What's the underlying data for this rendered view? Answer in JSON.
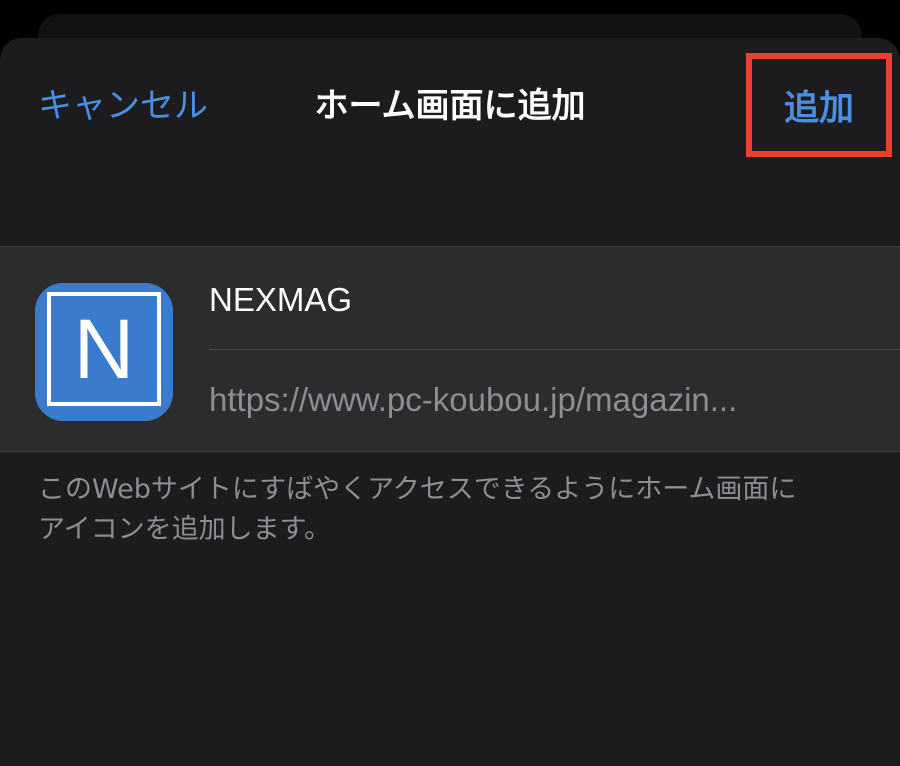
{
  "nav": {
    "cancel_label": "キャンセル",
    "title": "ホーム画面に追加",
    "add_label": "追加"
  },
  "bookmark": {
    "icon_letter": "N",
    "name": "NEXMAG",
    "url": "https://www.pc-koubou.jp/magazin..."
  },
  "footer": {
    "line1": "このWebサイトにすばやくアクセスできるようにホーム画面に",
    "line2": "アイコンを追加します。"
  },
  "colors": {
    "accent": "#4a90e2",
    "highlight_box": "#e8412c",
    "icon_background": "#3a7bcd",
    "sheet_background": "#1c1c1e",
    "cell_background": "#2c2c2e"
  }
}
